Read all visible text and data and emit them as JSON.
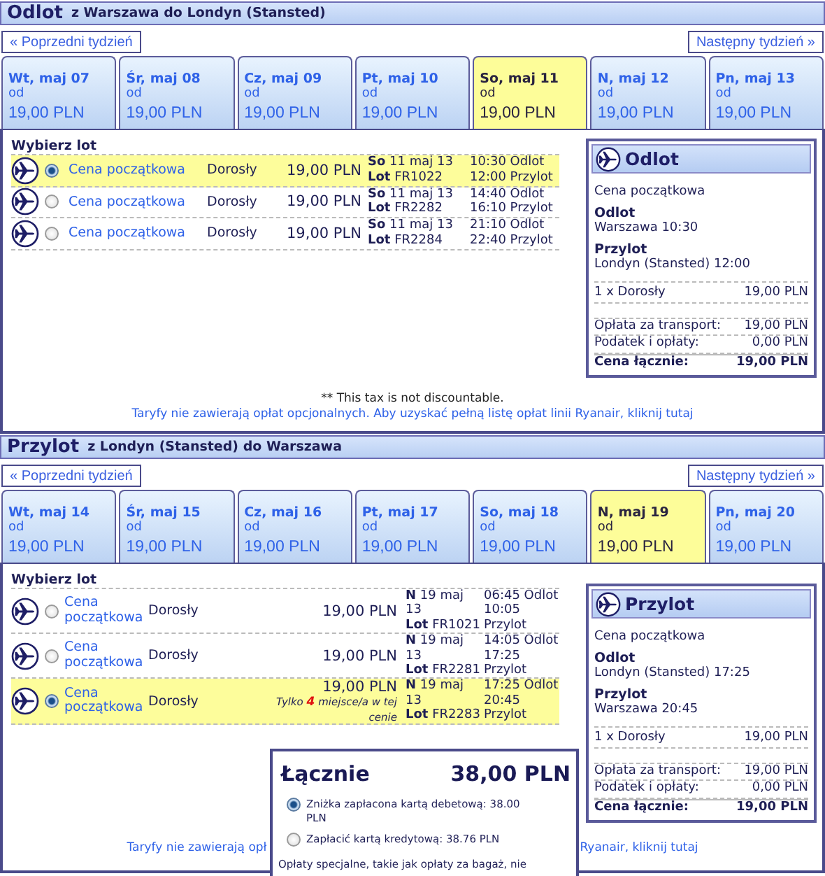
{
  "sections": [
    {
      "kind": "outbound",
      "title": "Odlot",
      "route": "z Warszawa do Londyn (Stansted)",
      "prev_week": "« Poprzedni tydzień",
      "next_week": "Następny tydzień »",
      "days": [
        {
          "date": "Wt, maj 07",
          "from": "od",
          "price": "19,00 PLN",
          "selected": false
        },
        {
          "date": "Śr, maj 08",
          "from": "od",
          "price": "19,00 PLN",
          "selected": false
        },
        {
          "date": "Cz, maj 09",
          "from": "od",
          "price": "19,00 PLN",
          "selected": false
        },
        {
          "date": "Pt, maj 10",
          "from": "od",
          "price": "19,00 PLN",
          "selected": false
        },
        {
          "date": "So, maj 11",
          "from": "od",
          "price": "19,00 PLN",
          "selected": true
        },
        {
          "date": "N, maj 12",
          "from": "od",
          "price": "19,00 PLN",
          "selected": false
        },
        {
          "date": "Pn, maj 13",
          "from": "od",
          "price": "19,00 PLN",
          "selected": false
        }
      ],
      "choose_label": "Wybierz lot",
      "flights": [
        {
          "selected": true,
          "fare": "Cena początkowa",
          "passenger": "Dorosły",
          "price": "19,00 PLN",
          "date_line": "**So** 11 maj 13",
          "flight_line": "**Lot** FR1022",
          "departure": "10:30 Odlot",
          "arrival": "12:00 Przylot"
        },
        {
          "selected": false,
          "fare": "Cena początkowa",
          "passenger": "Dorosły",
          "price": "19,00 PLN",
          "date_line": "**So** 11 maj 13",
          "flight_line": "**Lot** FR2282",
          "departure": "14:40 Odlot",
          "arrival": "16:10 Przylot"
        },
        {
          "selected": false,
          "fare": "Cena początkowa",
          "passenger": "Dorosły",
          "price": "19,00 PLN",
          "date_line": "**So** 11 maj 13",
          "flight_line": "**Lot** FR2284",
          "departure": "21:10 Odlot",
          "arrival": "22:40 Przylot"
        }
      ],
      "summary": {
        "title": "Odlot",
        "fare": "Cena początkowa",
        "departure_label": "Odlot",
        "departure": "Warszawa 10:30",
        "arrival_label": "Przylot",
        "arrival": "Londyn (Stansted) 12:00",
        "passenger_line": {
          "label": "1 x Dorosły",
          "amount": "19,00 PLN"
        },
        "charges": [
          {
            "label": "Opłata za transport:",
            "amount": "19,00 PLN"
          },
          {
            "label": "Podatek i opłaty:",
            "amount": "0,00 PLN"
          }
        ],
        "total": {
          "label": "Cena łącznie:",
          "amount": "19,00 PLN"
        }
      },
      "notes": [
        {
          "kind": "text",
          "text": "** This tax is not discountable."
        },
        {
          "kind": "link",
          "text": "Taryfy nie zawierają opłat opcjonalnych. Aby uzyskać pełną listę opłat linii Ryanair, kliknij tutaj"
        }
      ]
    },
    {
      "kind": "return",
      "title": "Przylot",
      "route": "z Londyn (Stansted) do Warszawa",
      "prev_week": "« Poprzedni tydzień",
      "next_week": "Następny tydzień »",
      "days": [
        {
          "date": "Wt, maj 14",
          "from": "od",
          "price": "19,00 PLN",
          "selected": false
        },
        {
          "date": "Śr, maj 15",
          "from": "od",
          "price": "19,00 PLN",
          "selected": false
        },
        {
          "date": "Cz, maj 16",
          "from": "od",
          "price": "19,00 PLN",
          "selected": false
        },
        {
          "date": "Pt, maj 17",
          "from": "od",
          "price": "19,00 PLN",
          "selected": false
        },
        {
          "date": "So, maj 18",
          "from": "od",
          "price": "19,00 PLN",
          "selected": false
        },
        {
          "date": "N, maj 19",
          "from": "od",
          "price": "19,00 PLN",
          "selected": true
        },
        {
          "date": "Pn, maj 20",
          "from": "od",
          "price": "19,00 PLN",
          "selected": false
        }
      ],
      "choose_label": "Wybierz lot",
      "flights": [
        {
          "selected": false,
          "fare": "Cena początkowa",
          "passenger": "Dorosły",
          "price": "19,00 PLN",
          "date_line": "**N** 19 maj 13",
          "flight_line": "**Lot** FR1021",
          "departure": "06:45 Odlot",
          "arrival": "10:05 Przylot"
        },
        {
          "selected": false,
          "fare": "Cena początkowa",
          "passenger": "Dorosły",
          "price": "19,00 PLN",
          "date_line": "**N** 19 maj 13",
          "flight_line": "**Lot** FR2281",
          "departure": "14:05 Odlot",
          "arrival": "17:25 Przylot"
        },
        {
          "selected": true,
          "fare": "Cena początkowa",
          "passenger": "Dorosły",
          "price": "19,00 PLN",
          "seat_note": {
            "before": "Tylko",
            "count": "4",
            "after": "miejsce/a w tej cenie"
          },
          "date_line": "**N** 19 maj 13",
          "flight_line": "**Lot** FR2283",
          "departure": "17:25 Odlot",
          "arrival": "20:45 Przylot"
        }
      ],
      "summary": {
        "title": "Przylot",
        "fare": "Cena początkowa",
        "departure_label": "Odlot",
        "departure": "Londyn (Stansted) 17:25",
        "arrival_label": "Przylot",
        "arrival": "Warszawa 20:45",
        "passenger_line": {
          "label": "1 x Dorosły",
          "amount": "19,00 PLN"
        },
        "charges": [
          {
            "label": "Opłata za transport:",
            "amount": "19,00 PLN"
          },
          {
            "label": "Podatek i opłaty:",
            "amount": "0,00 PLN"
          }
        ],
        "total": {
          "label": "Cena łącznie:",
          "amount": "19,00 PLN"
        }
      },
      "notes": [
        {
          "kind": "link_parts",
          "parts": [
            "Taryfy nie zawierają opł",
            "Ryanair, kliknij tutaj"
          ]
        }
      ]
    }
  ],
  "total_popup": {
    "label": "Łącznie",
    "amount": "38,00 PLN",
    "options": [
      {
        "text": "Zniżka zapłacona kartą debetową: 38.00 PLN",
        "selected": true
      },
      {
        "text": "Zapłacić kartą kredytową: 38.76 PLN",
        "selected": false
      }
    ],
    "note": "Opłaty specjalne, takie jak opłaty za bagaż, nie"
  }
}
